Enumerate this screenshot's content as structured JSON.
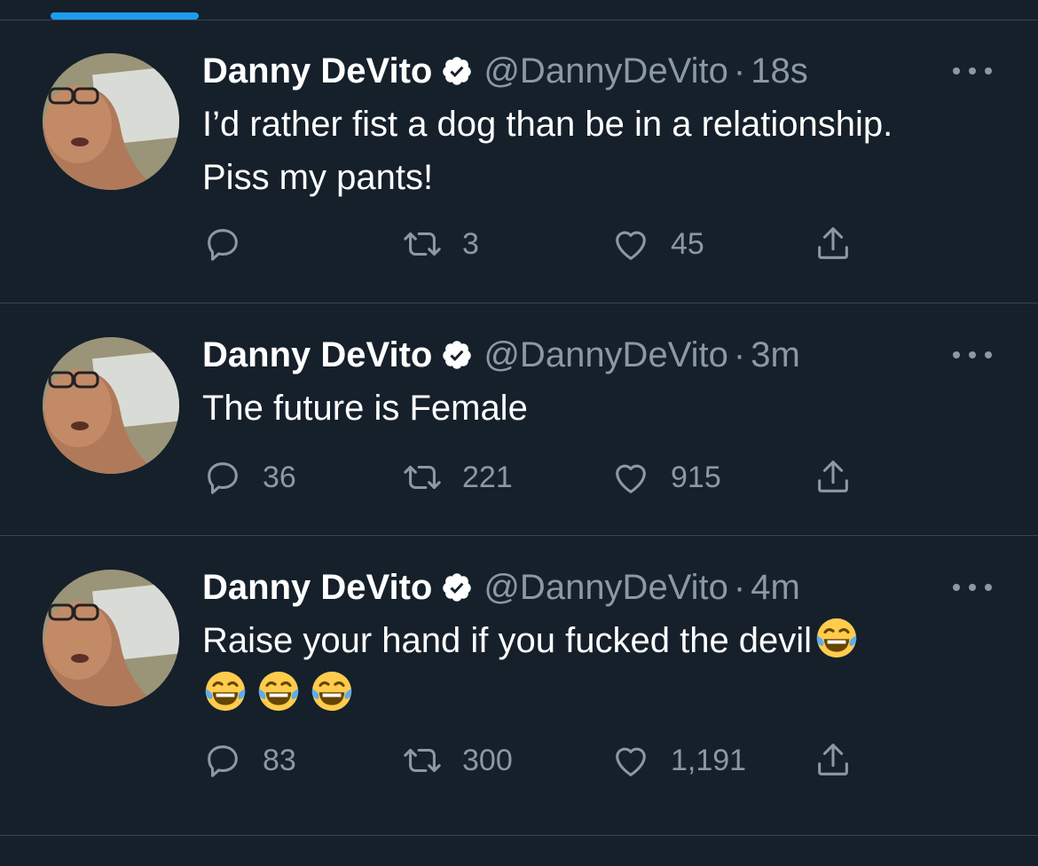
{
  "tweets": [
    {
      "name": "Danny DeVito",
      "handle": "@DannyDeVito",
      "separator": "·",
      "time": "18s",
      "text_lines": [
        "I’d rather fist a dog than be in a relationship.",
        "Piss my pants!"
      ],
      "emoji_line": [],
      "reply_count": "",
      "retweet_count": "3",
      "like_count": "45"
    },
    {
      "name": "Danny DeVito",
      "handle": "@DannyDeVito",
      "separator": "·",
      "time": "3m",
      "text_lines": [
        "The future is Female"
      ],
      "emoji_line": [],
      "reply_count": "36",
      "retweet_count": "221",
      "like_count": "915"
    },
    {
      "name": "Danny DeVito",
      "handle": "@DannyDeVito",
      "separator": "·",
      "time": "4m",
      "text_lines": [
        "Raise your hand if you fucked the devil"
      ],
      "emoji_line": [
        "face-with-tears-of-joy",
        "face-with-tears-of-joy",
        "face-with-tears-of-joy"
      ],
      "reply_count": "83",
      "retweet_count": "300",
      "like_count": "1,191"
    }
  ],
  "icons": {
    "verified": "verified-badge-icon",
    "more": "more-options-icon",
    "reply": "reply-icon",
    "retweet": "retweet-icon",
    "like": "heart-icon",
    "share": "share-icon",
    "inline_emoji": "face-with-tears-of-joy"
  },
  "colors": {
    "background": "#15202b",
    "divider": "#38444d",
    "secondary_text": "#8b98a5",
    "accent": "#1d9bf0"
  }
}
